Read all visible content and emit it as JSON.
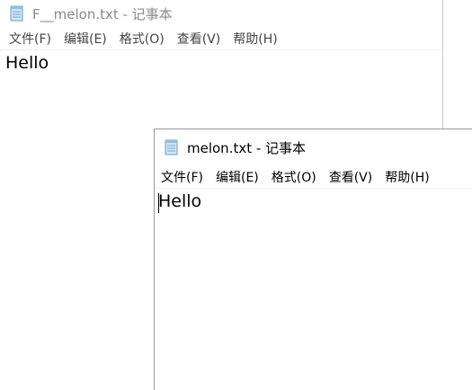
{
  "back_window": {
    "title": "F__melon.txt - 记事本",
    "menu": [
      "文件(F)",
      "编辑(E)",
      "格式(O)",
      "查看(V)",
      "帮助(H)"
    ],
    "content": "Hello"
  },
  "front_window": {
    "title": "melon.txt - 记事本",
    "menu": [
      "文件(F)",
      "编辑(E)",
      "格式(O)",
      "查看(V)",
      "帮助(H)"
    ],
    "content": "Hello"
  },
  "icons": {
    "notepad": "notepad-icon"
  }
}
